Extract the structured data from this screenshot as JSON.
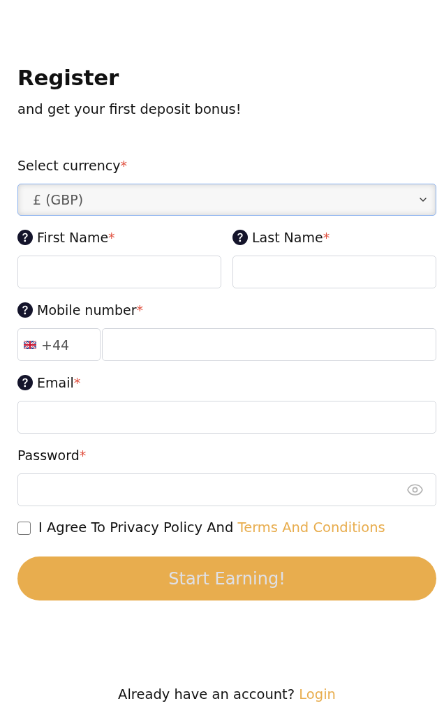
{
  "header": {
    "title": "Register",
    "subtitle": "and get your first deposit bonus!"
  },
  "form": {
    "rows": [
      {
        "fields": [
          {
            "kind": "select",
            "label": "Select currency",
            "required_mark": "*",
            "help": false,
            "value": "£ (GBP)",
            "focused": true
          }
        ]
      },
      {
        "fields": [
          {
            "kind": "text",
            "label": "First Name",
            "required_mark": "*",
            "help": true
          },
          {
            "kind": "text",
            "label": "Last Name",
            "required_mark": "*",
            "help": true
          }
        ]
      },
      {
        "fields": [
          {
            "kind": "phone",
            "label": "Mobile number",
            "required_mark": "*",
            "help": true,
            "country_code": "+44"
          }
        ]
      },
      {
        "fields": [
          {
            "kind": "text",
            "label": "Email",
            "required_mark": "*",
            "help": true
          }
        ]
      },
      {
        "fields": [
          {
            "kind": "password",
            "label": "Password",
            "required_mark": "*",
            "help": false
          }
        ]
      }
    ]
  },
  "agreement": {
    "checked": false,
    "text": "I Agree To Privacy Policy And",
    "link": "Terms And Conditions"
  },
  "submit": {
    "label": "Start Earning!",
    "disabled": true
  },
  "footer": {
    "text": "Already have an account?",
    "link": "Login"
  }
}
